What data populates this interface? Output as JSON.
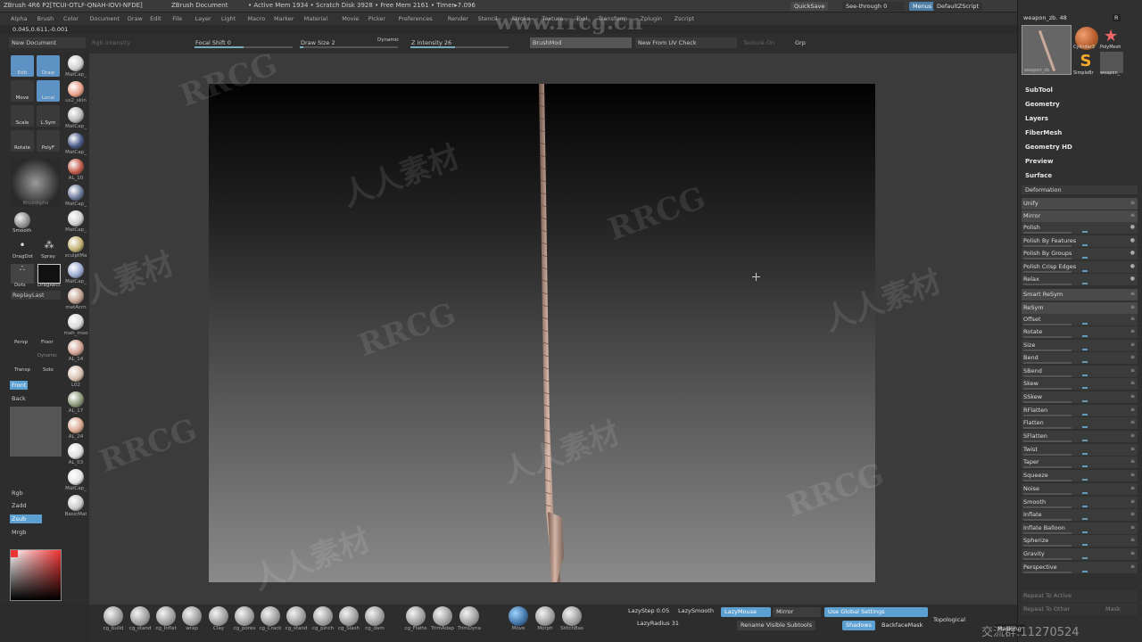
{
  "title_bar": {
    "app": "ZBrush 4R6 P2[TCUI-OTLF-QNAH-IOVI-NFDE]",
    "doc": "ZBrush Document",
    "stats": "• Active Mem 1934 • Scratch Disk 3928 • Free Mem 2161 • Timer▸7.096",
    "quicksave": "QuickSave",
    "see_through": "See-through 0",
    "menus": "Menus",
    "script": "DefaultZScript"
  },
  "menu": [
    "Alpha",
    "Brush",
    "Color",
    "Document",
    "Draw",
    "Edit",
    "File",
    "Layer",
    "Light",
    "Macro",
    "Marker",
    "Material",
    "Movie",
    "Picker",
    "Preferences",
    "Render",
    "Stencil",
    "Stroke",
    "Texture",
    "Tool",
    "Transform",
    "Zplugin",
    "Zscript"
  ],
  "coords": "0.045,0.611,-0.001",
  "toolbar": {
    "new_document": "New Document",
    "rgb_intensity": "Rgb Intensity",
    "focal_shift": "Focal Shift 0",
    "draw_size": "Draw Size 2",
    "dynamic": "Dynamic",
    "z_intensity": "Z Intensity 26",
    "brushmod": "BrushMod",
    "new_from_uv": "New From UV Check",
    "texture_on": "Texture On",
    "grp": "Grp"
  },
  "left_shelf": {
    "buttons": [
      "Edit",
      "Draw",
      "Move",
      "Local",
      "Scale",
      "L.Sym",
      "Rotate",
      "PolyF"
    ],
    "alpha_label": "BrushAlpha",
    "brushes": [
      "Smooth",
      "DragDot",
      "Spray",
      "Dots",
      "DragRect"
    ],
    "replay": "ReplayLast",
    "persp": "Persp",
    "floor": "Floor",
    "transp": "Transp",
    "solo": "Solo",
    "dynamic": "Dynamic",
    "front": "Front",
    "back": "Back",
    "rgb": "Rgb",
    "zadd": "Zadd",
    "zsub": "Zsub",
    "mrgb": "Mrgb",
    "materials": [
      "MatCap_",
      "us2_skin",
      "MatCap_",
      "MatCap_",
      "AL_10",
      "MatCap_",
      "MatCap_",
      "sculptMa",
      "MatCap_",
      "matAcrn",
      "mah_moo",
      "AL_14",
      "L02",
      "AL_17",
      "AL_24",
      "AL_03",
      "MatCap_",
      "BasicMat"
    ]
  },
  "right_panel": {
    "tool_name": "weapon_zb. 48",
    "r_label": "R",
    "thumbs": [
      "weapon_zb",
      "Cylinder3",
      "PolyMesh",
      "SimpleBr",
      "weapon_"
    ],
    "sections": [
      "SubTool",
      "Geometry",
      "Layers",
      "FiberMesh",
      "Geometry HD",
      "Preview",
      "Surface"
    ],
    "deformation_title": "Deformation",
    "deformation": [
      "Unify",
      "Mirror",
      "Polish",
      "Polish By Features",
      "Polish By Groups",
      "Polish Crisp Edges",
      "Relax",
      "Smart ReSym",
      "ReSym",
      "Offset",
      "Rotate",
      "Size",
      "Bend",
      "SBend",
      "Skew",
      "SSkew",
      "RFlatten",
      "Flatten",
      "SFlatten",
      "Twist",
      "Taper",
      "Squeeze",
      "Noise",
      "Smooth",
      "Inflate",
      "Inflate Balloon",
      "Spherize",
      "Gravity",
      "Perspective",
      "Repeat To Active",
      "Repeat To Other",
      "Mask"
    ]
  },
  "bottom_shelf": {
    "brushes": [
      "cg_build",
      "cg_stand",
      "cg_Inflat",
      "wrap",
      "Clay",
      "cg_pores",
      "cg_Crack",
      "cg_stand",
      "cg_pinch",
      "cg_Slash",
      "cg_dam",
      "cg_Flatte",
      "TrimAdap",
      "TrimDyna",
      "Move",
      "Morph",
      "StitchBas"
    ],
    "lazystep": "LazyStep 0.05",
    "lazysmooth": "LazySmooth",
    "lazymouse": "LazyMouse",
    "mirror": "Mirror",
    "use_global": "Use Global Settings",
    "lazyradius": "LazyRadius 31",
    "rename": "Rename Visible Subtools",
    "shadows": "Shadows",
    "backface": "BackfaceMask",
    "topological": "Topological",
    "masking": "Masking"
  },
  "watermarks": {
    "url": "www.rrcg.cn",
    "brand": "RRCG",
    "cn": "人人素材",
    "qq": "交流群:11270524"
  }
}
